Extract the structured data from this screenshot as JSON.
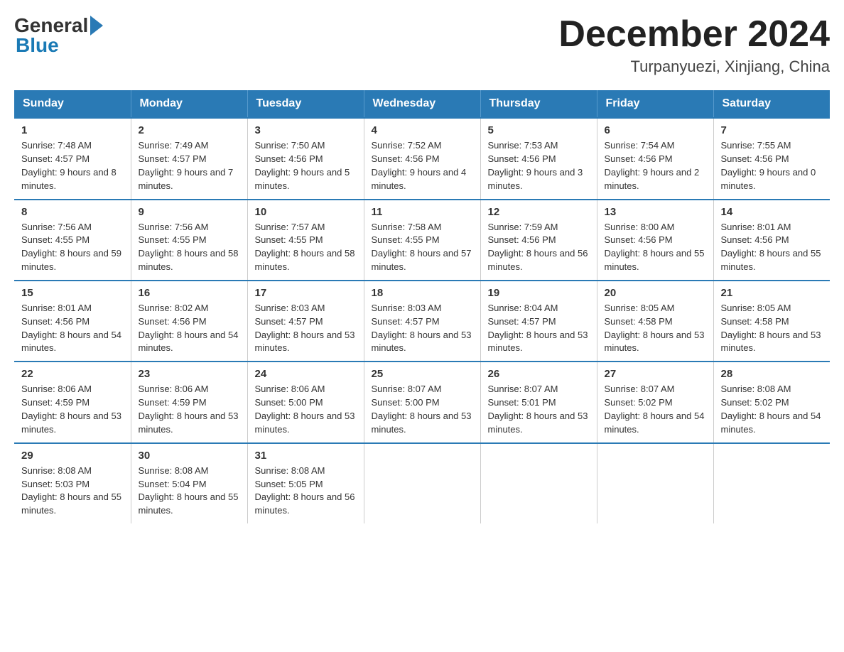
{
  "header": {
    "logo_general": "General",
    "logo_blue": "Blue",
    "month_title": "December 2024",
    "location": "Turpanyuezi, Xinjiang, China"
  },
  "weekdays": [
    "Sunday",
    "Monday",
    "Tuesday",
    "Wednesday",
    "Thursday",
    "Friday",
    "Saturday"
  ],
  "weeks": [
    [
      {
        "day": "1",
        "sunrise": "Sunrise: 7:48 AM",
        "sunset": "Sunset: 4:57 PM",
        "daylight": "Daylight: 9 hours and 8 minutes."
      },
      {
        "day": "2",
        "sunrise": "Sunrise: 7:49 AM",
        "sunset": "Sunset: 4:57 PM",
        "daylight": "Daylight: 9 hours and 7 minutes."
      },
      {
        "day": "3",
        "sunrise": "Sunrise: 7:50 AM",
        "sunset": "Sunset: 4:56 PM",
        "daylight": "Daylight: 9 hours and 5 minutes."
      },
      {
        "day": "4",
        "sunrise": "Sunrise: 7:52 AM",
        "sunset": "Sunset: 4:56 PM",
        "daylight": "Daylight: 9 hours and 4 minutes."
      },
      {
        "day": "5",
        "sunrise": "Sunrise: 7:53 AM",
        "sunset": "Sunset: 4:56 PM",
        "daylight": "Daylight: 9 hours and 3 minutes."
      },
      {
        "day": "6",
        "sunrise": "Sunrise: 7:54 AM",
        "sunset": "Sunset: 4:56 PM",
        "daylight": "Daylight: 9 hours and 2 minutes."
      },
      {
        "day": "7",
        "sunrise": "Sunrise: 7:55 AM",
        "sunset": "Sunset: 4:56 PM",
        "daylight": "Daylight: 9 hours and 0 minutes."
      }
    ],
    [
      {
        "day": "8",
        "sunrise": "Sunrise: 7:56 AM",
        "sunset": "Sunset: 4:55 PM",
        "daylight": "Daylight: 8 hours and 59 minutes."
      },
      {
        "day": "9",
        "sunrise": "Sunrise: 7:56 AM",
        "sunset": "Sunset: 4:55 PM",
        "daylight": "Daylight: 8 hours and 58 minutes."
      },
      {
        "day": "10",
        "sunrise": "Sunrise: 7:57 AM",
        "sunset": "Sunset: 4:55 PM",
        "daylight": "Daylight: 8 hours and 58 minutes."
      },
      {
        "day": "11",
        "sunrise": "Sunrise: 7:58 AM",
        "sunset": "Sunset: 4:55 PM",
        "daylight": "Daylight: 8 hours and 57 minutes."
      },
      {
        "day": "12",
        "sunrise": "Sunrise: 7:59 AM",
        "sunset": "Sunset: 4:56 PM",
        "daylight": "Daylight: 8 hours and 56 minutes."
      },
      {
        "day": "13",
        "sunrise": "Sunrise: 8:00 AM",
        "sunset": "Sunset: 4:56 PM",
        "daylight": "Daylight: 8 hours and 55 minutes."
      },
      {
        "day": "14",
        "sunrise": "Sunrise: 8:01 AM",
        "sunset": "Sunset: 4:56 PM",
        "daylight": "Daylight: 8 hours and 55 minutes."
      }
    ],
    [
      {
        "day": "15",
        "sunrise": "Sunrise: 8:01 AM",
        "sunset": "Sunset: 4:56 PM",
        "daylight": "Daylight: 8 hours and 54 minutes."
      },
      {
        "day": "16",
        "sunrise": "Sunrise: 8:02 AM",
        "sunset": "Sunset: 4:56 PM",
        "daylight": "Daylight: 8 hours and 54 minutes."
      },
      {
        "day": "17",
        "sunrise": "Sunrise: 8:03 AM",
        "sunset": "Sunset: 4:57 PM",
        "daylight": "Daylight: 8 hours and 53 minutes."
      },
      {
        "day": "18",
        "sunrise": "Sunrise: 8:03 AM",
        "sunset": "Sunset: 4:57 PM",
        "daylight": "Daylight: 8 hours and 53 minutes."
      },
      {
        "day": "19",
        "sunrise": "Sunrise: 8:04 AM",
        "sunset": "Sunset: 4:57 PM",
        "daylight": "Daylight: 8 hours and 53 minutes."
      },
      {
        "day": "20",
        "sunrise": "Sunrise: 8:05 AM",
        "sunset": "Sunset: 4:58 PM",
        "daylight": "Daylight: 8 hours and 53 minutes."
      },
      {
        "day": "21",
        "sunrise": "Sunrise: 8:05 AM",
        "sunset": "Sunset: 4:58 PM",
        "daylight": "Daylight: 8 hours and 53 minutes."
      }
    ],
    [
      {
        "day": "22",
        "sunrise": "Sunrise: 8:06 AM",
        "sunset": "Sunset: 4:59 PM",
        "daylight": "Daylight: 8 hours and 53 minutes."
      },
      {
        "day": "23",
        "sunrise": "Sunrise: 8:06 AM",
        "sunset": "Sunset: 4:59 PM",
        "daylight": "Daylight: 8 hours and 53 minutes."
      },
      {
        "day": "24",
        "sunrise": "Sunrise: 8:06 AM",
        "sunset": "Sunset: 5:00 PM",
        "daylight": "Daylight: 8 hours and 53 minutes."
      },
      {
        "day": "25",
        "sunrise": "Sunrise: 8:07 AM",
        "sunset": "Sunset: 5:00 PM",
        "daylight": "Daylight: 8 hours and 53 minutes."
      },
      {
        "day": "26",
        "sunrise": "Sunrise: 8:07 AM",
        "sunset": "Sunset: 5:01 PM",
        "daylight": "Daylight: 8 hours and 53 minutes."
      },
      {
        "day": "27",
        "sunrise": "Sunrise: 8:07 AM",
        "sunset": "Sunset: 5:02 PM",
        "daylight": "Daylight: 8 hours and 54 minutes."
      },
      {
        "day": "28",
        "sunrise": "Sunrise: 8:08 AM",
        "sunset": "Sunset: 5:02 PM",
        "daylight": "Daylight: 8 hours and 54 minutes."
      }
    ],
    [
      {
        "day": "29",
        "sunrise": "Sunrise: 8:08 AM",
        "sunset": "Sunset: 5:03 PM",
        "daylight": "Daylight: 8 hours and 55 minutes."
      },
      {
        "day": "30",
        "sunrise": "Sunrise: 8:08 AM",
        "sunset": "Sunset: 5:04 PM",
        "daylight": "Daylight: 8 hours and 55 minutes."
      },
      {
        "day": "31",
        "sunrise": "Sunrise: 8:08 AM",
        "sunset": "Sunset: 5:05 PM",
        "daylight": "Daylight: 8 hours and 56 minutes."
      },
      null,
      null,
      null,
      null
    ]
  ]
}
